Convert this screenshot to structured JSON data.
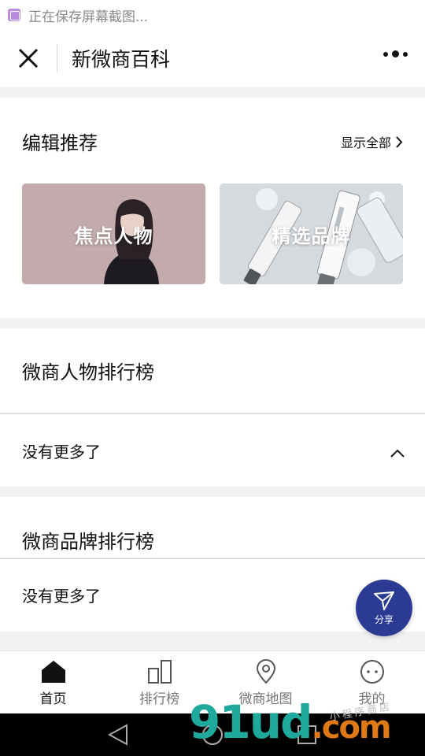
{
  "status_bar": {
    "text": "正在保存屏幕截图..."
  },
  "nav": {
    "title": "新微商百科"
  },
  "editor_picks": {
    "title": "编辑推荐",
    "show_all": "显示全部",
    "cards": [
      {
        "label": "焦点人物"
      },
      {
        "label": "精选品牌"
      }
    ]
  },
  "people_ranking": {
    "title": "微商人物排行榜",
    "empty_text": "没有更多了"
  },
  "brand_ranking": {
    "title": "微商品牌排行榜",
    "empty_text": "没有更多了"
  },
  "fab": {
    "label": "分享"
  },
  "tabs": [
    {
      "label": "首页",
      "icon": "home-icon",
      "active": true
    },
    {
      "label": "排行榜",
      "icon": "ranking-icon",
      "active": false
    },
    {
      "label": "微商地图",
      "icon": "map-pin-icon",
      "active": false
    },
    {
      "label": "我的",
      "icon": "profile-icon",
      "active": false
    }
  ],
  "watermark": {
    "brand": "91ud",
    "suffix": ".com",
    "sub": "小程序商店"
  },
  "colors": {
    "accent": "#2b3a93",
    "page_bg": "#f2f2f2",
    "active_tab": "#111111",
    "inactive_tab": "#777777"
  }
}
